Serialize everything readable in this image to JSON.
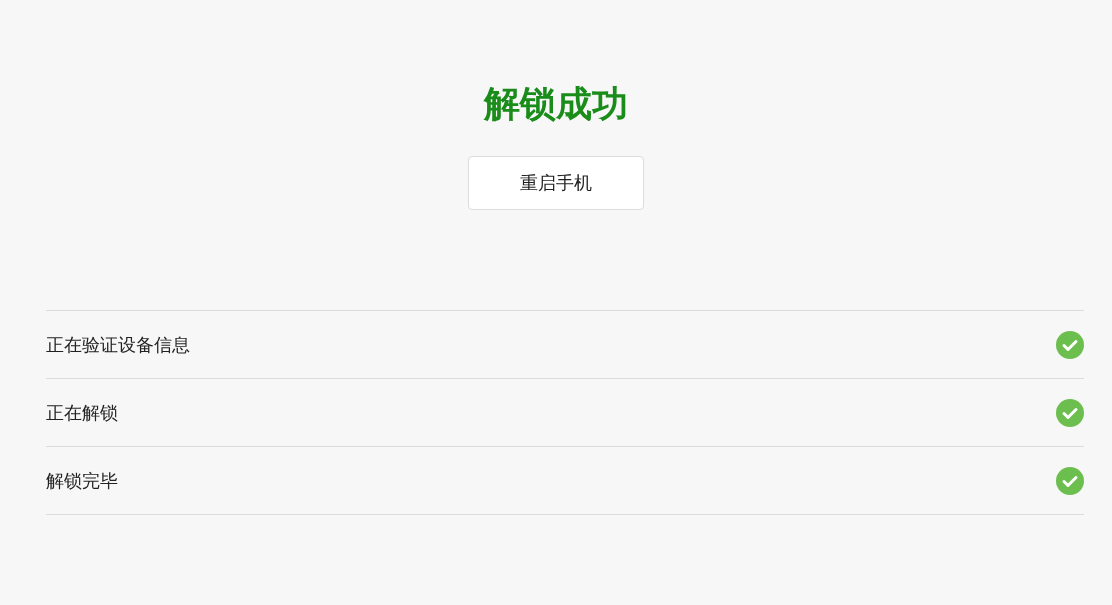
{
  "title": "解锁成功",
  "button": {
    "label": "重启手机"
  },
  "steps": [
    {
      "label": "正在验证设备信息",
      "done": true
    },
    {
      "label": "正在解锁",
      "done": true
    },
    {
      "label": "解锁完毕",
      "done": true
    }
  ]
}
